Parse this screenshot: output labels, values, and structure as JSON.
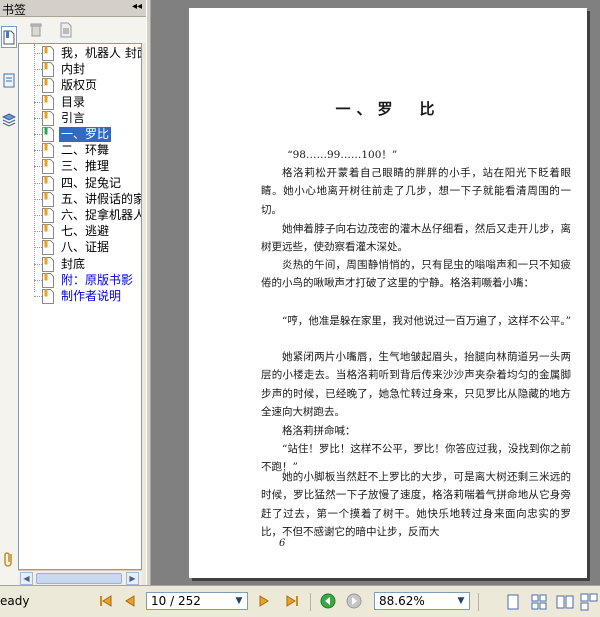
{
  "bookmarks_panel": {
    "title": "书签",
    "collapse_glyph": "◂◂",
    "items": [
      {
        "label": "我，机器人 封面",
        "type": "normal"
      },
      {
        "label": "内封",
        "type": "normal"
      },
      {
        "label": "版权页",
        "type": "normal"
      },
      {
        "label": "目录",
        "type": "normal"
      },
      {
        "label": "引言",
        "type": "normal"
      },
      {
        "label": "一、罗比",
        "type": "selected"
      },
      {
        "label": "二、环舞",
        "type": "normal"
      },
      {
        "label": "三、推理",
        "type": "normal"
      },
      {
        "label": "四、捉兔记",
        "type": "normal"
      },
      {
        "label": "五、讲假话的家伙",
        "type": "normal"
      },
      {
        "label": "六、捉拿机器人",
        "type": "normal"
      },
      {
        "label": "七、逃避",
        "type": "normal"
      },
      {
        "label": "八、证据",
        "type": "normal"
      },
      {
        "label": "封底",
        "type": "normal"
      },
      {
        "label": "附：原版书影",
        "type": "link"
      },
      {
        "label": "制作者说明",
        "type": "link"
      }
    ]
  },
  "document": {
    "chapter_title": "一、罗　比",
    "paragraphs": [
      "“98……99……100！”",
      "格洛莉松开蒙着自己眼睛的胖胖的小手，站在阳光下眨着眼睛。她小心地离开树往前走了几步，想一下子就能看清周围的一切。",
      "她伸着脖子向右边茂密的灌木丛仔细看，然后又走开儿步，离树更远些，使劲察看灌木深处。",
      "炎热的午间，周围静悄悄的，只有昆虫的嗡嗡声和一只不知疲倦的小鸟的啾啾声才打破了这里的宁静。格洛莉噘着小嘴：",
      "“哼，他准是躲在家里，我对他说过一百万遍了，这样不公平。”",
      "她紧闭两片小嘴唇，生气地皱起眉头，抬腿向林荫道另一头两层的小楼走去。当格洛莉听到背后传来沙沙声夹杂着均匀的金属脚步声的时候，已经晚了，她急忙转过身来，只见罗比从隐藏的地方全速向大树跑去。",
      "格洛莉拼命喊：",
      "“站住！罗比！这样不公平，罗比！你答应过我，没找到你之前不跑！”",
      "她的小脚板当然赶不上罗比的大步，可是离大树还剩三米远的时候，罗比猛然一下子放慢了速度，格洛莉喘着气拼命地从它身旁赶了过去，第一个摸着了树干。她快乐地转过身来面向忠实的罗比，不但不感谢它的暗中让步，反而大"
    ],
    "page_number": "6"
  },
  "status_bar": {
    "status_text": "eady",
    "page_field": "10 / 252",
    "zoom_field": "88.62%"
  },
  "colors": {
    "selection": "#316ac5",
    "link": "#0000ee",
    "doc_background": "#808080",
    "chrome": "#ece9d8"
  },
  "icons": [
    "bookmarks-panel-icon",
    "pages-panel-icon",
    "layers-panel-icon",
    "attachment-icon",
    "delete-bookmark-icon",
    "bookmark-options-icon",
    "bookmark-page-icon",
    "first-page-icon",
    "previous-page-icon",
    "next-page-icon",
    "last-page-icon",
    "go-back-icon",
    "go-forward-icon",
    "single-page-view-icon",
    "continuous-view-icon",
    "facing-view-icon",
    "continuous-facing-view-icon"
  ]
}
